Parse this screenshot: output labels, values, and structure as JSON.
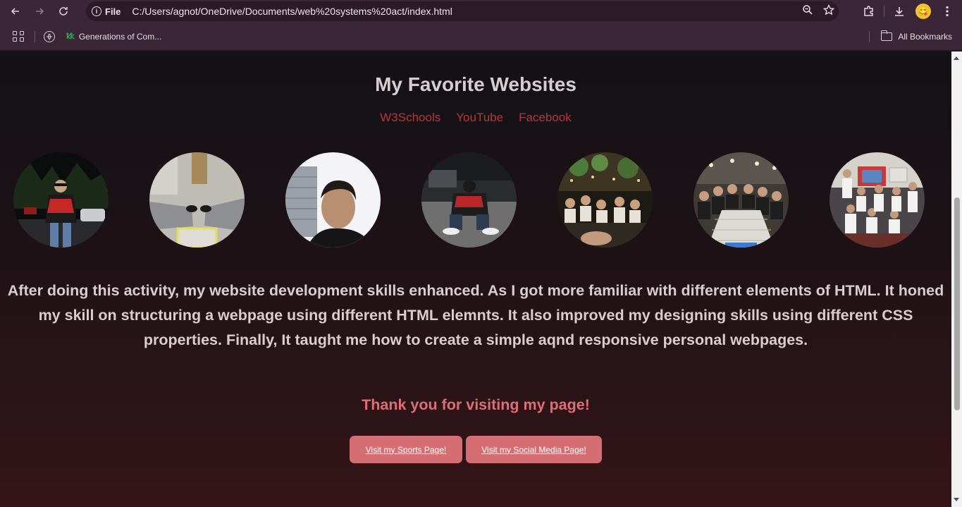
{
  "browser": {
    "site_chip_label": "File",
    "url": "C:/Users/agnot/OneDrive/Documents/web%20systems%20act/index.html",
    "bookmarks": [
      {
        "label": "Generations of Com..."
      }
    ],
    "all_bookmarks_label": "All Bookmarks"
  },
  "page": {
    "title": "My Favorite Websites",
    "links": [
      "W3Schools",
      "YouTube",
      "Facebook"
    ],
    "paragraph": "After doing this activity, my website development skills enhanced. As I got more familiar with different elements of HTML. It honed my skill on structuring a webpage using different HTML elemnts. It also improved my designing skills using different CSS properties. Finally, It taught me how to create a simple aqnd responsive personal webpages.",
    "thanks": "Thank you for visiting my page!",
    "buttons": {
      "sports": "Visit my Sports Page!",
      "social": "Visit my Social Media Page!"
    }
  },
  "colors": {
    "link": "#b6363b",
    "thanks": "#de6e74",
    "button": "#d46e72",
    "chrome": "#3a2636"
  }
}
